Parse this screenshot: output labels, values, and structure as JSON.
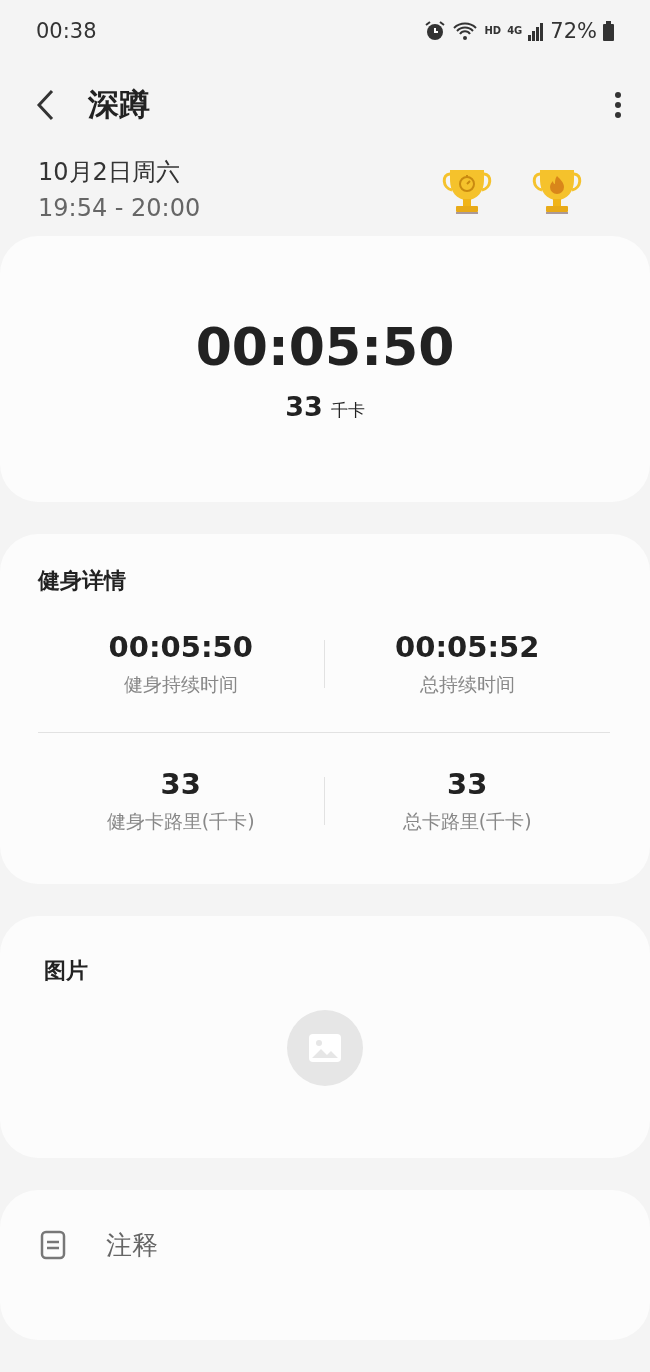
{
  "status_bar": {
    "time": "00:38",
    "network_label": "HD",
    "network_type": "4G",
    "battery": "72%"
  },
  "header": {
    "title": "深蹲"
  },
  "session": {
    "date": "10月2日周六",
    "time_range": "19:54 - 20:00",
    "trophies": [
      {
        "kind": "stopwatch"
      },
      {
        "kind": "flame"
      }
    ]
  },
  "summary": {
    "duration": "00:05:50",
    "calories": "33",
    "calories_unit": "千卡"
  },
  "details": {
    "title": "健身详情",
    "rows": [
      [
        {
          "value": "00:05:50",
          "label": "健身持续时间"
        },
        {
          "value": "00:05:52",
          "label": "总持续时间"
        }
      ],
      [
        {
          "value": "33",
          "label": "健身卡路里(千卡)"
        },
        {
          "value": "33",
          "label": "总卡路里(千卡)"
        }
      ]
    ]
  },
  "pictures": {
    "title": "图片"
  },
  "notes": {
    "label": "注释"
  }
}
